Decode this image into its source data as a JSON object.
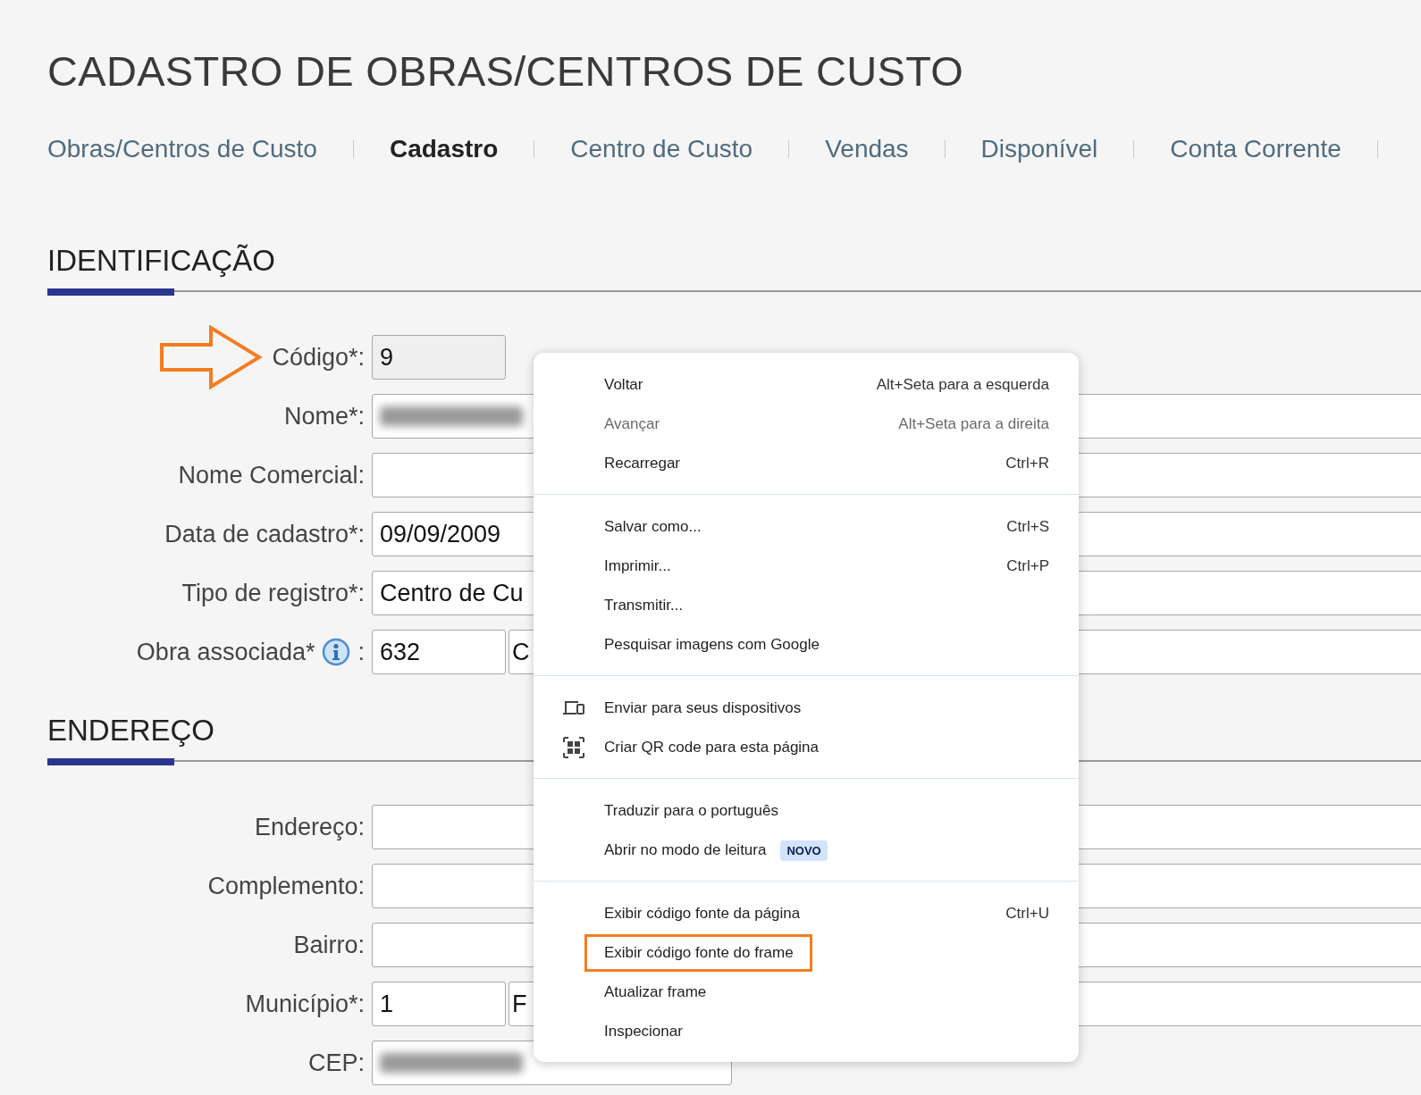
{
  "page_title": "CADASTRO DE OBRAS/CENTROS DE CUSTO",
  "tabs": [
    {
      "label": "Obras/Centros de Custo",
      "selected": false
    },
    {
      "label": "Cadastro",
      "selected": true
    },
    {
      "label": "Centro de Custo",
      "selected": false
    },
    {
      "label": "Vendas",
      "selected": false
    },
    {
      "label": "Disponível",
      "selected": false
    },
    {
      "label": "Conta Corrente",
      "selected": false
    }
  ],
  "sections": [
    {
      "title": "IDENTIFICAÇÃO",
      "rows": [
        {
          "label": "Código*:",
          "pointer": true,
          "fields": [
            {
              "kind": "short",
              "value": "9",
              "readonly": true
            }
          ]
        },
        {
          "label": "Nome*:",
          "fields": [
            {
              "kind": "full",
              "redacted": true
            }
          ]
        },
        {
          "label": "Nome Comercial:",
          "fields": [
            {
              "kind": "full"
            }
          ]
        },
        {
          "label": "Data de cadastro*:",
          "fields": [
            {
              "kind": "full",
              "value": "09/09/2009"
            }
          ]
        },
        {
          "label": "Tipo de registro*:",
          "fields": [
            {
              "kind": "full",
              "value": "Centro de Cu"
            }
          ]
        },
        {
          "label": "Obra associada*",
          "info": true,
          "suffix": ":",
          "fields": [
            {
              "kind": "short",
              "value": "632"
            },
            {
              "kind": "full",
              "value": "C"
            }
          ]
        }
      ]
    },
    {
      "title": "ENDEREÇO",
      "rows": [
        {
          "label": "Endereço:",
          "fields": [
            {
              "kind": "full"
            }
          ]
        },
        {
          "label": "Complemento:",
          "fields": [
            {
              "kind": "full"
            }
          ]
        },
        {
          "label": "Bairro:",
          "fields": [
            {
              "kind": "full"
            }
          ]
        },
        {
          "label": "Município*:",
          "fields": [
            {
              "kind": "short",
              "value": "1"
            },
            {
              "kind": "full",
              "value": "F"
            }
          ]
        },
        {
          "label": "CEP:",
          "fields": [
            {
              "kind": "medium",
              "redacted": true
            }
          ]
        }
      ]
    }
  ],
  "context_menu": {
    "sections": [
      {
        "items": [
          {
            "label": "Voltar",
            "shortcut": "Alt+Seta para a esquerda",
            "disabled": false
          },
          {
            "label": "Avançar",
            "shortcut": "Alt+Seta para a direita",
            "disabled": true
          },
          {
            "label": "Recarregar",
            "shortcut": "Ctrl+R",
            "disabled": false
          }
        ]
      },
      {
        "items": [
          {
            "label": "Salvar como...",
            "shortcut": "Ctrl+S",
            "disabled": false
          },
          {
            "label": "Imprimir...",
            "shortcut": "Ctrl+P",
            "disabled": false
          },
          {
            "label": "Transmitir...",
            "disabled": false
          },
          {
            "label": "Pesquisar imagens com Google",
            "disabled": false
          }
        ]
      },
      {
        "items": [
          {
            "label": "Enviar para seus dispositivos",
            "kind": "icon",
            "disabled": false
          },
          {
            "label": "Criar QR code para esta página",
            "kind": "icon",
            "disabled": false
          }
        ]
      },
      {
        "items": [
          {
            "label": "Traduzir para o português",
            "disabled": false
          },
          {
            "label": "Abrir no modo de leitura",
            "badge": "NOVO",
            "disabled": false
          }
        ]
      },
      {
        "items": [
          {
            "label": "Exibir código fonte da página",
            "shortcut": "Ctrl+U",
            "disabled": false
          },
          {
            "label": "Exibir código fonte do frame",
            "highlighted": true,
            "disabled": false
          },
          {
            "label": "Atualizar frame",
            "disabled": false
          },
          {
            "label": "Inspecionar",
            "disabled": false
          }
        ]
      }
    ]
  }
}
